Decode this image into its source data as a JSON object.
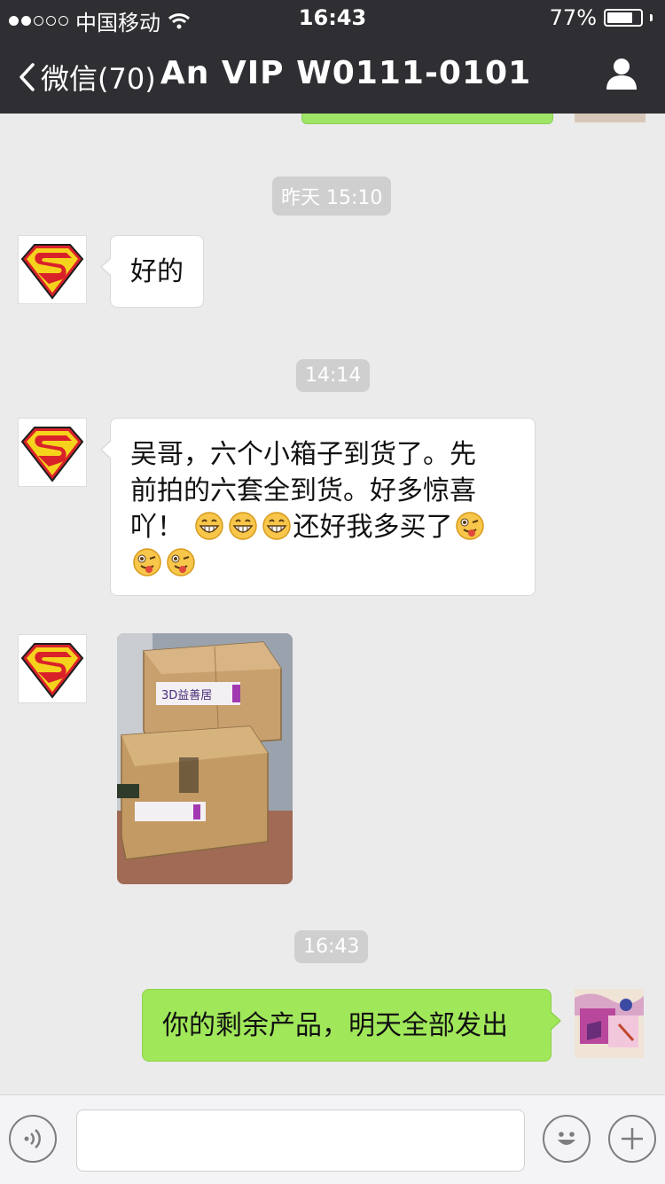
{
  "status_bar": {
    "carrier": "中国移动",
    "time": "16:43",
    "battery": "77%",
    "battery_level": 0.77
  },
  "nav": {
    "back_label": "微信(70)",
    "title": "An VIP W0111-0101"
  },
  "messages": {
    "t1": "昨天 15:10",
    "m1": "好的",
    "t2": "14:14",
    "m2_line1": "吴哥，六个小箱子到货了。先",
    "m2_line2": "前拍的六套全到货。好多惊喜",
    "m2_line3a": "吖！",
    "m2_line3b": "还好我多买了",
    "m3_photo_label": "3D益善居",
    "t3": "16:43",
    "m4": "你的剩余产品，明天全部发出"
  },
  "input_bar": {
    "placeholder": ""
  },
  "colors": {
    "nav_bg": "#2f2f33",
    "chat_bg": "#ebebeb",
    "my_bubble": "#a0e75a",
    "time_pill": "#cfcfcf"
  }
}
